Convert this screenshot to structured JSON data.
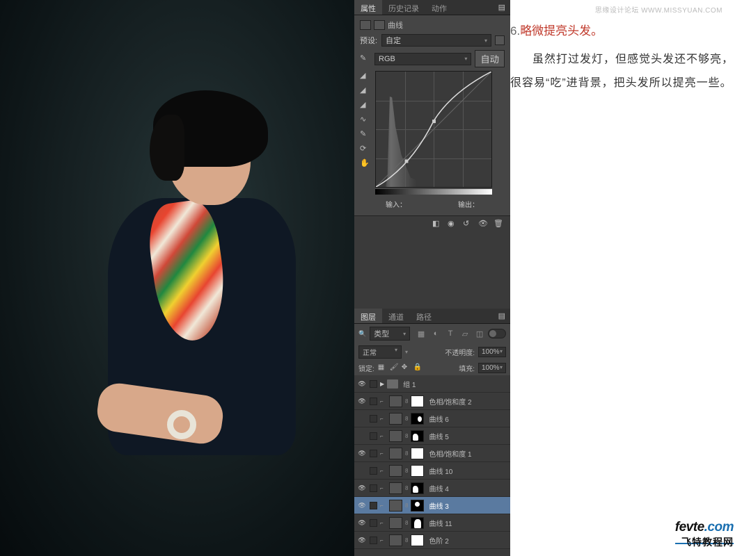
{
  "watermark": "思缘设计论坛  WWW.MISSYUAN.COM",
  "article": {
    "step_num": "6.",
    "step_title": "略微提亮头发。",
    "body": "虽然打过发灯，但感觉头发还不够亮，很容易“吃”进背景，把头发所以提亮一些。"
  },
  "logo": {
    "main_a": "fevte",
    "main_b": ".com",
    "sub": "飞特教程网"
  },
  "properties_panel": {
    "tabs": [
      "属性",
      "历史记录",
      "动作"
    ],
    "active_tab": 0,
    "adjustment_label": "曲线",
    "preset_label": "预设:",
    "preset_value": "自定",
    "channel_value": "RGB",
    "auto_btn": "自动",
    "input_label": "输入：",
    "output_label": "输出："
  },
  "layers_panel": {
    "tabs": [
      "图层",
      "通道",
      "路径"
    ],
    "active_tab": 0,
    "filter_label": "类型",
    "blend_mode": "正常",
    "opacity_label": "不透明度:",
    "opacity_value": "100%",
    "lock_label": "锁定:",
    "fill_label": "填充:",
    "fill_value": "100%",
    "layers": [
      {
        "name": "组 1",
        "type": "group",
        "visible": true
      },
      {
        "name": "色相/饱和度 2",
        "type": "adj",
        "mask": "white",
        "visible": true
      },
      {
        "name": "曲线 6",
        "type": "adj",
        "mask": "shape-sm",
        "visible": false
      },
      {
        "name": "曲线 5",
        "type": "adj",
        "mask": "shape-bl",
        "visible": false
      },
      {
        "name": "色相/饱和度 1",
        "type": "adj",
        "mask": "white",
        "visible": true
      },
      {
        "name": "曲线 10",
        "type": "adj",
        "mask": "white",
        "visible": false
      },
      {
        "name": "曲线 4",
        "type": "adj",
        "mask": "shape-bl",
        "visible": true
      },
      {
        "name": "曲线 3",
        "type": "adj",
        "mask": "shape-sm2",
        "visible": true,
        "selected": true
      },
      {
        "name": "曲线 11",
        "type": "adj",
        "mask": "silhouette",
        "visible": true
      },
      {
        "name": "色阶 2",
        "type": "adj",
        "mask": "white",
        "visible": true
      }
    ]
  }
}
